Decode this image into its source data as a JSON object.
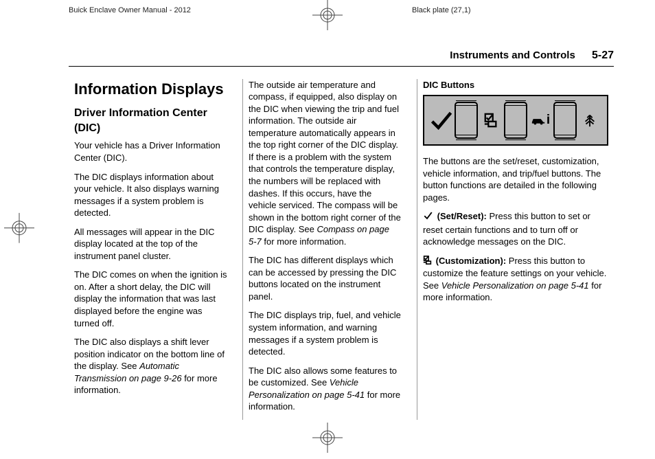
{
  "meta": {
    "manual_title": "Buick Enclave Owner Manual - 2012",
    "plate": "Black plate (27,1)"
  },
  "header": {
    "section": "Instruments and Controls",
    "page": "5-27"
  },
  "col1": {
    "h1": "Information Displays",
    "h2": "Driver Information Center (DIC)",
    "p1": "Your vehicle has a Driver Information Center (DIC).",
    "p2": "The DIC displays information about your vehicle. It also displays warning messages if a system problem is detected.",
    "p3": "All messages will appear in the DIC display located at the top of the instrument panel cluster.",
    "p4": "The DIC comes on when the ignition is on. After a short delay, the DIC will display the information that was last displayed before the engine was turned off.",
    "p5a": "The DIC also displays a shift lever position indicator on the bottom line of the display. See ",
    "p5i": "Automatic Transmission on page 9‑26",
    "p5b": " for more information."
  },
  "col2": {
    "p1a": "The outside air temperature and compass, if equipped, also display on the DIC when viewing the trip and fuel information. The outside air temperature automatically appears in the top right corner of the DIC display. If there is a problem with the system that controls the temperature display, the numbers will be replaced with dashes. If this occurs, have the vehicle serviced. The compass will be shown in the bottom right corner of the DIC display. See ",
    "p1i": "Compass on page 5‑7",
    "p1b": " for more information.",
    "p2": "The DIC has different displays which can be accessed by pressing the DIC buttons located on the instrument panel.",
    "p3": "The DIC displays trip, fuel, and vehicle system information, and warning messages if a system problem is detected.",
    "p4a": "The DIC also allows some features to be customized. See ",
    "p4i": "Vehicle Personalization on page 5‑41",
    "p4b": " for more information."
  },
  "col3": {
    "h3": "DIC Buttons",
    "intro": "The buttons are the set/reset, customization, vehicle information, and trip/fuel buttons. The button functions are detailed in the following pages.",
    "set_label": " (Set/Reset):",
    "set_text": "  Press this button to set or reset certain functions and to turn off or acknowledge messages on the DIC.",
    "cust_label": " (Customization):",
    "cust_text_a": "  Press this button to customize the feature settings on your vehicle. See ",
    "cust_text_i": "Vehicle Personalization on page 5‑41",
    "cust_text_b": " for more information."
  },
  "icons": {
    "check": "set-reset-check-icon",
    "custom": "customization-icon",
    "vehicle": "vehicle-info-icon",
    "trip": "trip-fuel-icon"
  }
}
